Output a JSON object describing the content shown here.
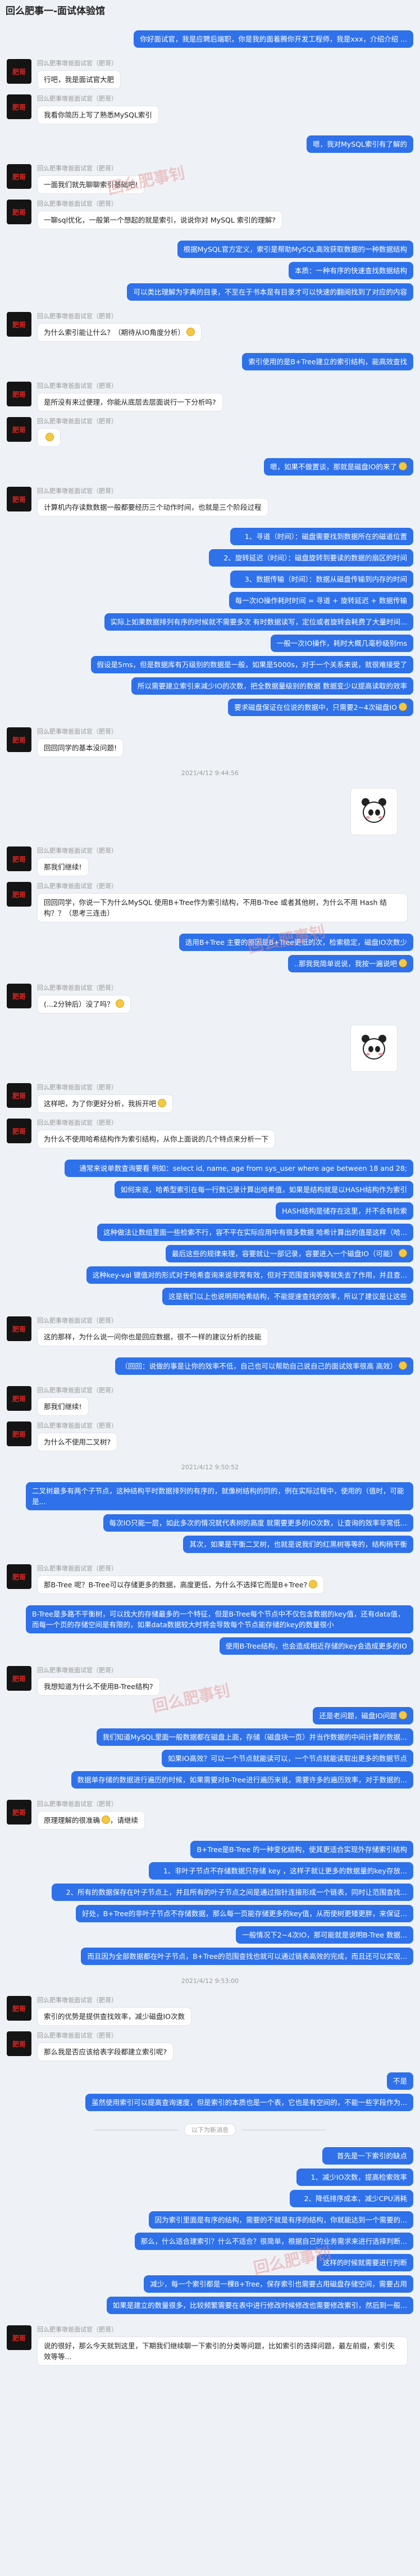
{
  "title": "回么肥事一-面试体验馆",
  "sender_name": "回么肥事墩爸面试官（肥哥）",
  "avatar_text": "肥哥",
  "watermark": "回么肥事钊",
  "messages": [
    {
      "side": "r",
      "t": "你好面试官，我是应聘后端职，你是我的面着腾你开发工程师，我是xxx，介绍介绍 ..."
    },
    {
      "side": "l",
      "t": "行吧，我是面试官大肥"
    },
    {
      "side": "l",
      "t": "我看你简历上写了熟悉MySQL索引"
    },
    {
      "side": "r",
      "t": "嗯，我对MySQL索引有了解的"
    },
    {
      "side": "l",
      "t": "一面我们就先聊聊索引基础吧!"
    },
    {
      "side": "l",
      "t": "一聊sql优化，一般第一个想起的就是索引，说说你对 MySQL 索引的理解?"
    },
    {
      "side": "r",
      "t": "根据MySQL官方定义，索引是帮助MySQL高效获取数据的一种数据结构"
    },
    {
      "side": "r",
      "t": "本质：一种有序的快速查找数据结构"
    },
    {
      "side": "r",
      "t": "可以类比理解为字典的目录，不至在于书本是有目录才可以快速的翻阅找到了对应的内容"
    },
    {
      "side": "l",
      "t": "为什么索引能让什么？（期待从IO角度分析）",
      "emoji": true
    },
    {
      "side": "r",
      "t": "索引使用的是B+Tree建立的索引结构，能高效查找"
    },
    {
      "side": "l",
      "t": "是所没有来过便理，你能从底层去层面说行一下分析吗?"
    },
    {
      "side": "l",
      "t": "",
      "emoji": true
    },
    {
      "side": "r",
      "t": "嗯，如果不做置谈，那就是磁盘IO的来了",
      "emoji": true
    },
    {
      "side": "l",
      "t": "计算机内存读数数据一般都要经历三个动作时间，也就是三个阶段过程"
    },
    {
      "side": "r",
      "t": "1、寻道（时间）：磁盘需要找到数据所在的磁道位置",
      "ind": true
    },
    {
      "side": "r",
      "t": "2、旋转延迟（时间）：磁盘旋转到要读的数据的扇区的时间",
      "ind": true
    },
    {
      "side": "r",
      "t": "3、数据传输（时间）：数据从磁盘传输到内存的时间",
      "ind": true
    },
    {
      "side": "r",
      "t": "每一次IO操作耗时时间 = 寻道 + 旋转延迟 + 数据传输"
    },
    {
      "side": "r",
      "t": "实际上如果数据排列有序的时候就不需要多次 有时数据读写，定位或者旋转会耗费了大量时间..."
    },
    {
      "side": "r",
      "t": "一般一次IO操作，耗时大概几毫秒级别ms"
    },
    {
      "side": "r",
      "t": "假设是5ms，但是数据库有万级别的数据是一般，如果是5000s，对于一个关系来说，就很难接受了"
    },
    {
      "side": "r",
      "t": "所以需要建立索引来减少IO的次数，把全数据量级别的数据 数据变少以提高读取的效率"
    },
    {
      "side": "r",
      "t": "要求磁盘保证在位说的数据中，只需要2~4次磁盘IO",
      "emoji": true
    },
    {
      "side": "l",
      "t": "回回同学的基本没问题!"
    },
    {
      "side": "ts",
      "t": "2021/4/12 9:44:56"
    },
    {
      "side": "sticker"
    },
    {
      "side": "l",
      "t": "那我们继续!"
    },
    {
      "side": "l",
      "t": "回回同学，你说一下为什么MySQL 使用B+Tree作为索引结构，不用B-Tree 或者其他树，为什么不用 Hash 结构？？（思考三连击）"
    },
    {
      "side": "r",
      "t": "选用B+Tree 主要的原因是B+Tree更低的次，检索稳定，磁盘IO次数少"
    },
    {
      "side": "r",
      "t": "..那我我简单说说，我按一遍说吧",
      "emoji": true
    },
    {
      "side": "l",
      "t": "(...2分钟后）没了吗？",
      "emoji": true
    },
    {
      "side": "sticker2"
    },
    {
      "side": "l",
      "t": "这样吧，为了你更好分析，我拆开吧",
      "emoji": true
    },
    {
      "side": "l",
      "t": "为什么不使用哈希结构作为索引结构，从你上面说的几个特点来分析一下"
    },
    {
      "side": "r",
      "t": "通常来说单数查询要看 例如：select id, name, age from sys_user where age between 18 and 28;",
      "ind": true
    },
    {
      "side": "r",
      "t": "如何来说，哈希型索引在每一行数记录计算出哈希值，如果是结构就是以HASH结构作为索引"
    },
    {
      "side": "r",
      "t": "HASH结构是储存在这里，并不会有检索"
    },
    {
      "side": "r",
      "t": "这种做法让数组里面一些检索不行，容不平在实际应用中有很多数据 哈希计算出的值是这样（哈..."
    },
    {
      "side": "r",
      "t": "最后这些的规律来理，容要就让一部记录，容要进入一个磁盘IO（可能）",
      "emoji": true
    },
    {
      "side": "r",
      "t": "这种key-val 键值对的形式对于哈希查询来说非常有效，但对于范围查询等等就失去了作用，并且查..."
    },
    {
      "side": "r",
      "t": "这是我们以上也说明用哈希结构，不能提速查找的效率，所以了建议是让这些"
    },
    {
      "side": "l",
      "t": "这的那样，为什么说一问你也是回应数据，很不一样的建议分析的技能"
    },
    {
      "side": "r",
      "t": "（回回：说做的事是让你的效率不低，自己也可以帮助自己说自己的面试效率很高 高效）",
      "emoji": true
    },
    {
      "side": "l",
      "t": "那我们继续!"
    },
    {
      "side": "l",
      "t": "为什么不使用二叉树?"
    },
    {
      "side": "ts",
      "t": "2021/4/12 9:50:52"
    },
    {
      "side": "r",
      "t": "二叉树最多有两个子节点，这种结构平时数据排列的有序的，就像树结构的同的，例在实际过程中，使用的（值时，可能是..."
    },
    {
      "side": "r",
      "t": "每次IO只能一层，如此多次的情况就代表树的高度 就需要更多的IO次数，让查询的效率非常低..."
    },
    {
      "side": "r",
      "t": "其次，如果是平衡二叉树，也就是说我们的红黑树等等的，结构稍平衡"
    },
    {
      "side": "l",
      "t": "那B-Tree 呢？B-Tree可以存储更多的数据，高度更低，为什么不选择它而是B+Tree?",
      "emoji": true
    },
    {
      "side": "r",
      "t": "B-Tree是多路不平衡树，可以找大的存储最多的一个特征，但是B-Tree每个节点中不仅包含数据的key值，还有data值，而每一个页的存储空间是有限的，如果data数据较大时将会导致每个节点能存储的key的数量很小"
    },
    {
      "side": "r",
      "t": "使用B-Tree结构，也会造成相近存储的key会造成更多的IO"
    },
    {
      "side": "l",
      "t": "我想知道为什么不使用B-Tree结构?"
    },
    {
      "side": "r",
      "t": "还是老问题，磁盘IO问题",
      "emoji": true
    },
    {
      "side": "r",
      "t": "我们知道MySQL里面一般数据都在磁盘上面，存储（磁盘块一页）并当作数据的中间计算的数据..."
    },
    {
      "side": "r",
      "t": "如果IO高效？可以一个节点就能读可以，一个节点就能读取出更多的数据节点"
    },
    {
      "side": "r",
      "t": "数据单存储的数据进行遍历的时候，如果需要对B-Tree进行遍历来说，需要许多的遍历效率，对于数据的..."
    },
    {
      "side": "l",
      "t": "原理理解的很准确",
      "emoji": true,
      "t2": "，请继续"
    },
    {
      "side": "r",
      "t": "B+Tree是B-Tree 的一种变化结构，使其更适合实现外存储索引结构"
    },
    {
      "side": "r",
      "t": "1、非叶子节点不存储数据只存储 key ，这样子就让更多的数据量的key存放...",
      "ind": true
    },
    {
      "side": "r",
      "t": "2、所有的数据保存在叶子节点上，并且所有的叶子节点之间是通过指针连接形成一个链表，同时让范围查找...",
      "ind": true
    },
    {
      "side": "r",
      "t": "好处，B+Tree的非叶子节点不存储数据，那么每一页能存储更多的key值，从而使树更矮更胖，来保证..."
    },
    {
      "side": "r",
      "t": "一般情况下2~4次IO，那可能就是说明B-Tree 数据..."
    },
    {
      "side": "r",
      "t": "而且因为全部数据都在叶子节点，B+Tree的范围查找也就可以通过链表高效的完成，而且还可以实现..."
    },
    {
      "side": "ts",
      "t": "2021/4/12 9:53:00"
    },
    {
      "side": "l",
      "t": "索引的优势是提供查找效率，减少磁盘IO次数"
    },
    {
      "side": "l",
      "t": "那么我是否应该给表字段都建立索引呢?"
    },
    {
      "side": "r",
      "t": "不是"
    },
    {
      "side": "r",
      "t": "虽然使用索引可以提高查询速度，但是索引的本质也是一个表，它也是有空间的，不能一些字段作为..."
    },
    {
      "side": "sep",
      "t": "以下为新消息"
    },
    {
      "side": "r",
      "t": "首先是一下索引的缺点",
      "ind": true
    },
    {
      "side": "r",
      "t": "1、减少IO次数，提高检索效率",
      "ind": true
    },
    {
      "side": "r",
      "t": "2、降低排序成本，减少CPU消耗",
      "ind": true
    },
    {
      "side": "r",
      "t": "因为索引里面是有序的结构，需要的不就是有序的结构，你就能达到一个需要的..."
    },
    {
      "side": "r",
      "t": "那么，什么适合建索引？什么不适合？很简单，根据自己的业务需求来进行选择判断..."
    },
    {
      "side": "r",
      "t": "这样的时候就需要进行判断"
    },
    {
      "side": "r",
      "t": "减少，每一个索引都是一棵B+Tree，保存索引也需要占用磁盘存储空间，需要占用"
    },
    {
      "side": "r",
      "t": "如果是建立的数量很多，比较频繁需要在表中进行修改时候修改也需要修改索引，然后到一般..."
    },
    {
      "side": "l",
      "t": "说的很好，那么今天就到这里，下期我们继续聊一下索引的分类等问题，比如索引的选择问题，最左前缀，索引失效等等..."
    }
  ]
}
